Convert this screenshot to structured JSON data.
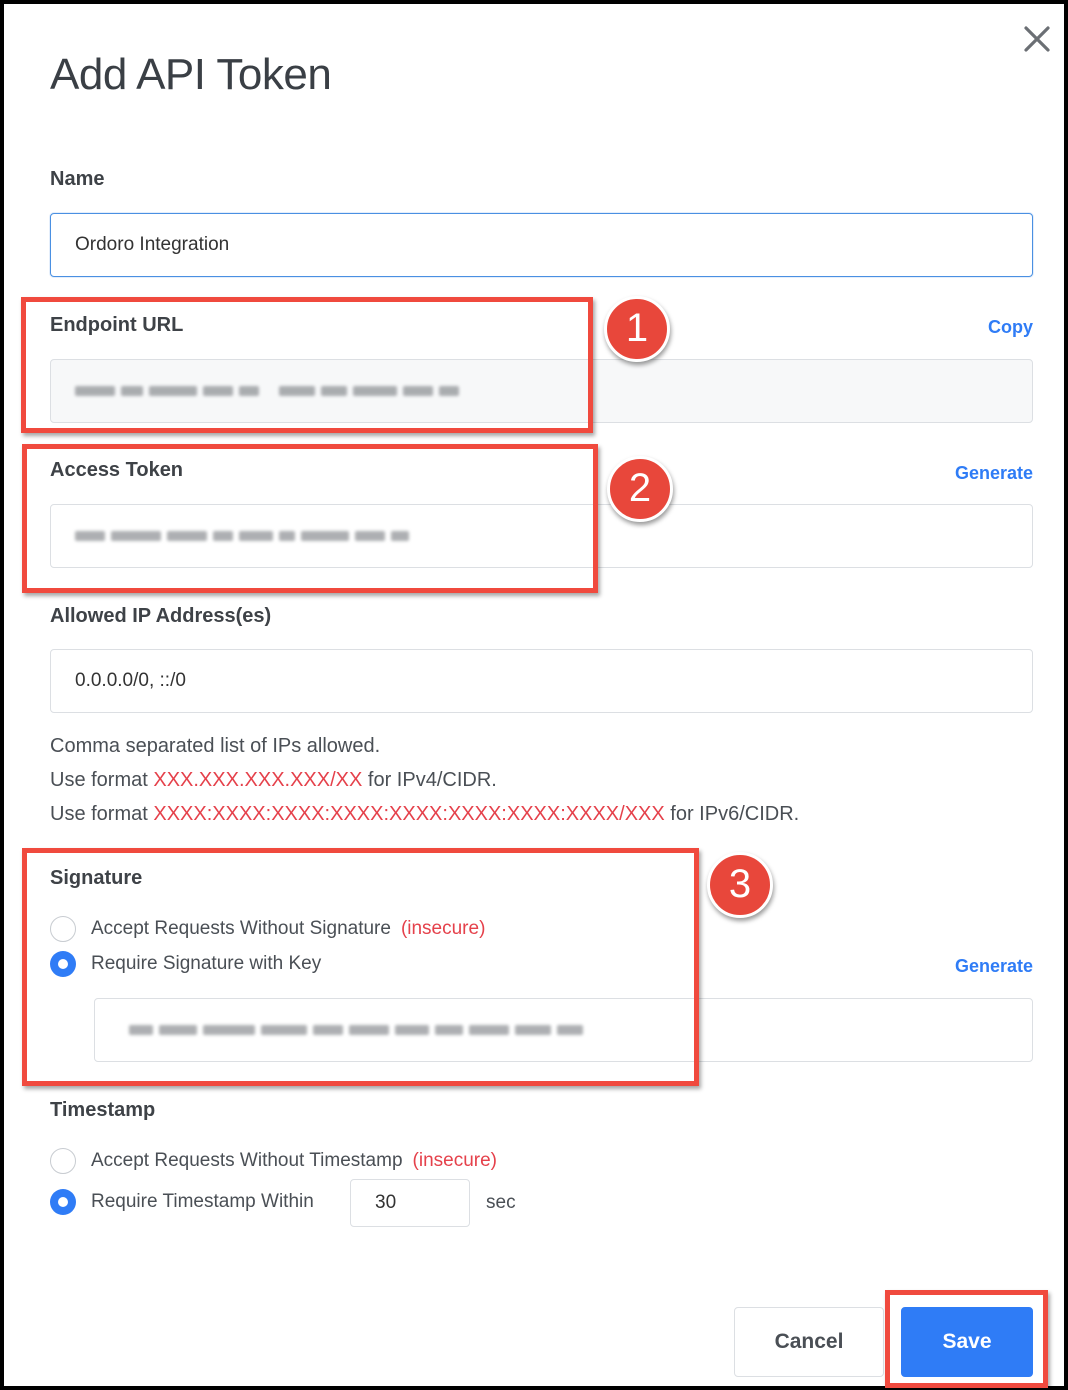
{
  "dialog": {
    "title": "Add API Token",
    "close_icon": "close-icon"
  },
  "name_field": {
    "label": "Name",
    "value": "Ordoro Integration"
  },
  "endpoint": {
    "label": "Endpoint URL",
    "action": "Copy"
  },
  "access_token": {
    "label": "Access Token",
    "action": "Generate"
  },
  "allowed_ips": {
    "label": "Allowed IP Address(es)",
    "value": "0.0.0.0/0, ::/0",
    "help_line1": "Comma separated list of IPs allowed.",
    "help_line2_prefix": "Use format ",
    "help_line2_format": "XXX.XXX.XXX.XXX/XX",
    "help_line2_suffix": " for IPv4/CIDR.",
    "help_line3_prefix": "Use format ",
    "help_line3_format": "XXXX:XXXX:XXXX:XXXX:XXXX:XXXX:XXXX:XXXX/XXX",
    "help_line3_suffix": " for IPv6/CIDR."
  },
  "signature": {
    "label": "Signature",
    "option1": "Accept Requests Without Signature",
    "option1_tag": "(insecure)",
    "option2": "Require Signature with Key",
    "action": "Generate",
    "selected": "option2"
  },
  "timestamp": {
    "label": "Timestamp",
    "option1": "Accept Requests Without Timestamp",
    "option1_tag": "(insecure)",
    "option2": "Require Timestamp Within",
    "value": "30",
    "unit": "sec",
    "selected": "option2"
  },
  "footer": {
    "cancel": "Cancel",
    "save": "Save"
  },
  "annotations": [
    "1",
    "2",
    "3"
  ],
  "colors": {
    "accent": "#2f7cf6",
    "danger": "#e5414b",
    "highlight": "#f04a3e"
  }
}
